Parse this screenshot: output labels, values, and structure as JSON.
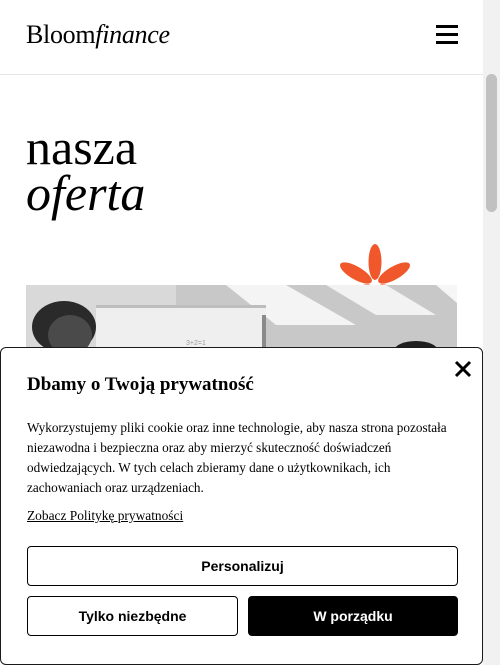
{
  "header": {
    "logo_main": "Bloom",
    "logo_italic": "finance",
    "menu_icon": "hamburger-menu-icon"
  },
  "hero": {
    "title_line1": "nasza",
    "title_line2": "oferta",
    "decoration_icon": "asterisk-icon",
    "accent_color": "#f0582b"
  },
  "cookie_banner": {
    "title": "Dbamy o Twoją prywatność",
    "close_icon": "close-icon",
    "body": "Wykorzystujemy pliki cookie oraz inne technologie, aby nasza strona pozostała niezawodna i bezpieczna oraz aby mierzyć skuteczność doświadczeń odwiedzających. W tych celach zbieramy dane o użytkownikach, ich zachowaniach oraz urządzeniach.",
    "policy_link": "Zobacz Politykę prywatności",
    "buttons": {
      "personalize": "Personalizuj",
      "necessary_only": "Tylko niezbędne",
      "accept": "W porządku"
    }
  }
}
